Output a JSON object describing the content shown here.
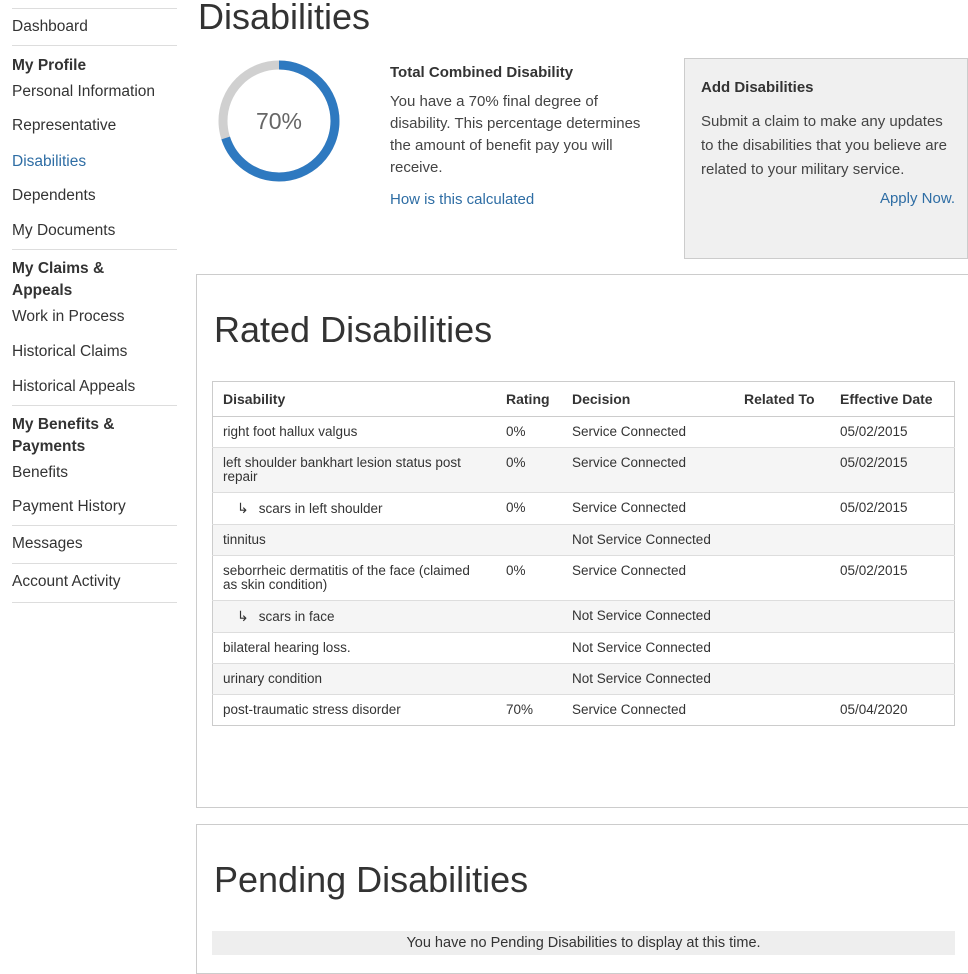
{
  "sidebar": {
    "dashboard": "Dashboard",
    "profile_heading": "My Profile",
    "profile_items": [
      "Personal Information",
      "Representative",
      "Disabilities",
      "Dependents",
      "My Documents"
    ],
    "claims_heading_1": "My Claims &",
    "claims_heading_2": "Appeals",
    "claims_items": [
      "Work in Process",
      "Historical Claims",
      "Historical Appeals"
    ],
    "benefits_heading_1": "My Benefits &",
    "benefits_heading_2": "Payments",
    "benefits_items": [
      "Benefits",
      "Payment History"
    ],
    "messages": "Messages",
    "account_activity": "Account Activity"
  },
  "page_title": "Disabilities",
  "combined": {
    "percent_label": "70%",
    "percent_value": 70,
    "title": "Total Combined Disability",
    "text": "You have a 70% final degree of disability. This percentage determines the amount of benefit pay you will receive.",
    "link": "How is this calculated",
    "ring_color": "#2e79c0",
    "track_color": "#d0d0d0"
  },
  "add_box": {
    "title": "Add Disabilities",
    "text": "Submit a claim to make any updates to the disabilities that you believe are related to your military service.",
    "link": "Apply Now."
  },
  "rated": {
    "title": "Rated Disabilities",
    "headers": [
      "Disability",
      "Rating",
      "Decision",
      "Related To",
      "Effective Date"
    ],
    "rows": [
      {
        "disability": "right foot hallux valgus",
        "rating": "0%",
        "decision": "Service Connected",
        "related": "",
        "date": "05/02/2015",
        "sub": false
      },
      {
        "disability": "left shoulder bankhart lesion status post repair",
        "rating": "0%",
        "decision": "Service Connected",
        "related": "",
        "date": "05/02/2015",
        "sub": false
      },
      {
        "disability": "scars in left shoulder",
        "rating": "0%",
        "decision": "Service Connected",
        "related": "",
        "date": "05/02/2015",
        "sub": true
      },
      {
        "disability": "tinnitus",
        "rating": "",
        "decision": "Not Service Connected",
        "related": "",
        "date": "",
        "sub": false
      },
      {
        "disability": "seborrheic dermatitis of the face (claimed as skin condition)",
        "rating": "0%",
        "decision": "Service Connected",
        "related": "",
        "date": "05/02/2015",
        "sub": false
      },
      {
        "disability": "scars in face",
        "rating": "",
        "decision": "Not Service Connected",
        "related": "",
        "date": "",
        "sub": true
      },
      {
        "disability": "bilateral hearing loss.",
        "rating": "",
        "decision": "Not Service Connected",
        "related": "",
        "date": "",
        "sub": false
      },
      {
        "disability": "urinary condition",
        "rating": "",
        "decision": "Not Service Connected",
        "related": "",
        "date": "",
        "sub": false
      },
      {
        "disability": "post-traumatic stress disorder",
        "rating": "70%",
        "decision": "Service Connected",
        "related": "",
        "date": "05/04/2020",
        "sub": false
      }
    ]
  },
  "pending": {
    "title": "Pending Disabilities",
    "empty_message": "You have no Pending Disabilities to display at this time."
  }
}
